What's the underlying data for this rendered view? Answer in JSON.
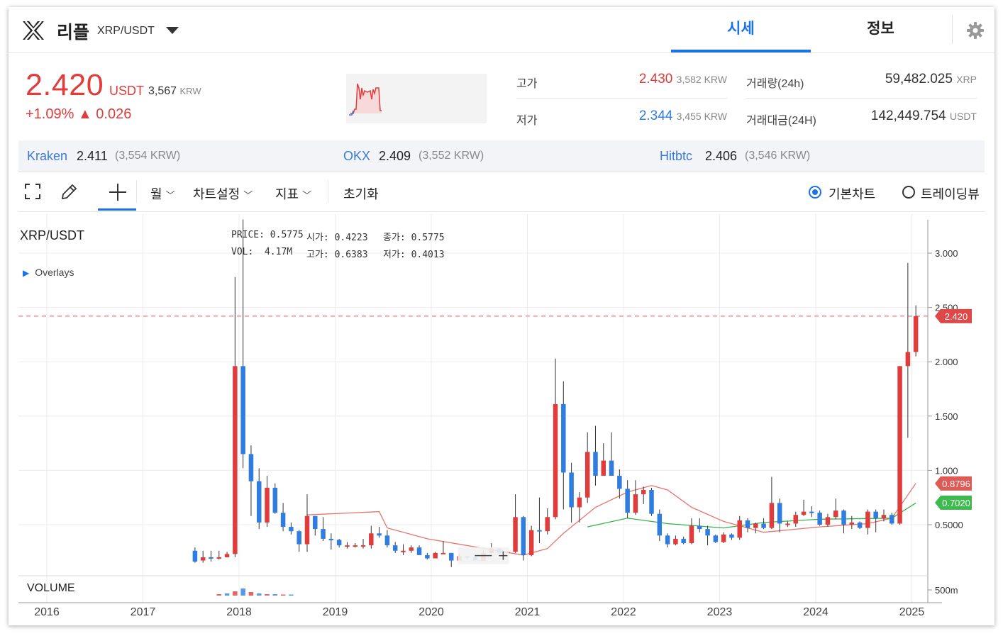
{
  "header": {
    "coin_name": "리플",
    "pair": "XRP/USDT",
    "tabs": [
      {
        "label": "시세",
        "active": true
      },
      {
        "label": "정보",
        "active": false
      }
    ]
  },
  "price": {
    "last": "2.420",
    "unit": "USDT",
    "krw": "3,567",
    "krw_unit": "KRW",
    "change": "+1.09% ▲ 0.026"
  },
  "stats": {
    "high_label": "고가",
    "high_value": "2.430",
    "high_krw": "3,582 KRW",
    "low_label": "저가",
    "low_value": "2.344",
    "low_krw": "3,455 KRW",
    "vol_label": "거래량(24h)",
    "vol_value": "59,482.025",
    "vol_unit": "XRP",
    "amt_label": "거래대금(24H)",
    "amt_value": "142,449.754",
    "amt_unit": "USDT"
  },
  "exchanges": [
    {
      "name": "Kraken",
      "price": "2.411",
      "krw": "(3,554 KRW)"
    },
    {
      "name": "OKX",
      "price": "2.409",
      "krw": "(3,552 KRW)"
    },
    {
      "name": "Hitbtc",
      "price": "2.406",
      "krw": "(3,546 KRW)"
    }
  ],
  "toolbar": {
    "period": "월",
    "chart_settings": "차트설정",
    "indicators": "지표",
    "reset": "초기화",
    "basic_chart": "기본차트",
    "tradingview": "트레이딩뷰"
  },
  "chart": {
    "pair_label": "XRP/USDT",
    "overlays_label": "Overlays",
    "volume_label": "VOLUME",
    "legend": {
      "price_label": "PRICE:",
      "price": "0.5775",
      "open_label": "시가:",
      "open": "0.4223",
      "close_label": "종가:",
      "close": "0.5775",
      "vol_label": "VOL:",
      "vol": "4.17M",
      "high_label": "고가:",
      "high": "0.6383",
      "low_label": "저가:",
      "low": "0.4013"
    },
    "y_ticks": [
      "3.000",
      "2.500",
      "2.000",
      "1.500",
      "1.000",
      "0.5000"
    ],
    "vol_tick": "500m",
    "x_ticks": [
      "2016",
      "2017",
      "2018",
      "2019",
      "2020",
      "2021",
      "2022",
      "2023",
      "2024",
      "2025"
    ],
    "price_tag": "2.420",
    "ma_tag_1": "0.8796",
    "ma_tag_2": "0.7020",
    "colors": {
      "up": "#e03c3c",
      "down": "#2f7de1",
      "ma1": "#e8746a",
      "ma2": "#37b24d"
    }
  },
  "chart_data": {
    "type": "candlestick",
    "x_unit": "month",
    "series": [
      {
        "date": "2017-07",
        "o": 0.26,
        "h": 0.29,
        "l": 0.15,
        "c": 0.16
      },
      {
        "date": "2017-08",
        "o": 0.17,
        "h": 0.26,
        "l": 0.15,
        "c": 0.2
      },
      {
        "date": "2017-09",
        "o": 0.2,
        "h": 0.26,
        "l": 0.16,
        "c": 0.19
      },
      {
        "date": "2017-10",
        "o": 0.19,
        "h": 0.26,
        "l": 0.18,
        "c": 0.2
      },
      {
        "date": "2017-11",
        "o": 0.2,
        "h": 0.25,
        "l": 0.2,
        "c": 0.23
      },
      {
        "date": "2017-12",
        "o": 0.23,
        "h": 2.78,
        "l": 0.2,
        "c": 1.96
      },
      {
        "date": "2018-01",
        "o": 1.96,
        "h": 3.31,
        "l": 1.02,
        "c": 1.15
      },
      {
        "date": "2018-02",
        "o": 1.15,
        "h": 1.23,
        "l": 0.58,
        "c": 0.9
      },
      {
        "date": "2018-03",
        "o": 0.9,
        "h": 1.02,
        "l": 0.46,
        "c": 0.52
      },
      {
        "date": "2018-04",
        "o": 0.52,
        "h": 0.95,
        "l": 0.48,
        "c": 0.84
      },
      {
        "date": "2018-05",
        "o": 0.84,
        "h": 0.88,
        "l": 0.6,
        "c": 0.61
      },
      {
        "date": "2018-06",
        "o": 0.61,
        "h": 0.7,
        "l": 0.44,
        "c": 0.48
      },
      {
        "date": "2018-07",
        "o": 0.48,
        "h": 0.52,
        "l": 0.41,
        "c": 0.44
      },
      {
        "date": "2018-08",
        "o": 0.44,
        "h": 0.45,
        "l": 0.25,
        "c": 0.32
      },
      {
        "date": "2018-09",
        "o": 0.32,
        "h": 0.78,
        "l": 0.25,
        "c": 0.58
      },
      {
        "date": "2018-10",
        "o": 0.58,
        "h": 0.58,
        "l": 0.4,
        "c": 0.46
      },
      {
        "date": "2018-11",
        "o": 0.46,
        "h": 0.57,
        "l": 0.35,
        "c": 0.37
      },
      {
        "date": "2018-12",
        "o": 0.37,
        "h": 0.42,
        "l": 0.27,
        "c": 0.36
      },
      {
        "date": "2019-01",
        "o": 0.36,
        "h": 0.37,
        "l": 0.29,
        "c": 0.31
      },
      {
        "date": "2019-02",
        "o": 0.31,
        "h": 0.34,
        "l": 0.28,
        "c": 0.31
      },
      {
        "date": "2019-03",
        "o": 0.31,
        "h": 0.33,
        "l": 0.29,
        "c": 0.31
      },
      {
        "date": "2019-04",
        "o": 0.31,
        "h": 0.37,
        "l": 0.28,
        "c": 0.31
      },
      {
        "date": "2019-05",
        "o": 0.31,
        "h": 0.49,
        "l": 0.28,
        "c": 0.42
      },
      {
        "date": "2019-06",
        "o": 0.42,
        "h": 0.48,
        "l": 0.38,
        "c": 0.4
      },
      {
        "date": "2019-07",
        "o": 0.4,
        "h": 0.45,
        "l": 0.29,
        "c": 0.31
      },
      {
        "date": "2019-08",
        "o": 0.31,
        "h": 0.34,
        "l": 0.24,
        "c": 0.26
      },
      {
        "date": "2019-09",
        "o": 0.26,
        "h": 0.32,
        "l": 0.22,
        "c": 0.26
      },
      {
        "date": "2019-10",
        "o": 0.26,
        "h": 0.31,
        "l": 0.24,
        "c": 0.29
      },
      {
        "date": "2019-11",
        "o": 0.29,
        "h": 0.31,
        "l": 0.22,
        "c": 0.22
      },
      {
        "date": "2019-12",
        "o": 0.22,
        "h": 0.24,
        "l": 0.18,
        "c": 0.19
      },
      {
        "date": "2020-01",
        "o": 0.19,
        "h": 0.25,
        "l": 0.19,
        "c": 0.24
      },
      {
        "date": "2020-02",
        "o": 0.24,
        "h": 0.35,
        "l": 0.23,
        "c": 0.24
      },
      {
        "date": "2020-03",
        "o": 0.24,
        "h": 0.24,
        "l": 0.11,
        "c": 0.17
      },
      {
        "date": "2020-04",
        "o": 0.17,
        "h": 0.23,
        "l": 0.17,
        "c": 0.21
      },
      {
        "date": "2020-05",
        "o": 0.21,
        "h": 0.21,
        "l": 0.18,
        "c": 0.2
      },
      {
        "date": "2020-06",
        "o": 0.2,
        "h": 0.21,
        "l": 0.17,
        "c": 0.17
      },
      {
        "date": "2020-07",
        "o": 0.17,
        "h": 0.27,
        "l": 0.17,
        "c": 0.24
      },
      {
        "date": "2020-08",
        "o": 0.24,
        "h": 0.33,
        "l": 0.23,
        "c": 0.28
      },
      {
        "date": "2020-09",
        "o": 0.28,
        "h": 0.28,
        "l": 0.24,
        "c": 0.24
      },
      {
        "date": "2020-10",
        "o": 0.24,
        "h": 0.26,
        "l": 0.24,
        "c": 0.25
      },
      {
        "date": "2020-11",
        "o": 0.25,
        "h": 0.78,
        "l": 0.24,
        "c": 0.57
      },
      {
        "date": "2020-12",
        "o": 0.57,
        "h": 0.58,
        "l": 0.17,
        "c": 0.22
      },
      {
        "date": "2021-01",
        "o": 0.22,
        "h": 0.49,
        "l": 0.21,
        "c": 0.45
      },
      {
        "date": "2021-02",
        "o": 0.45,
        "h": 0.75,
        "l": 0.33,
        "c": 0.44
      },
      {
        "date": "2021-03",
        "o": 0.44,
        "h": 0.65,
        "l": 0.41,
        "c": 0.57
      },
      {
        "date": "2021-04",
        "o": 0.57,
        "h": 2.03,
        "l": 0.55,
        "c": 1.61
      },
      {
        "date": "2021-05",
        "o": 1.61,
        "h": 1.82,
        "l": 0.64,
        "c": 0.98
      },
      {
        "date": "2021-06",
        "o": 0.98,
        "h": 1.07,
        "l": 0.52,
        "c": 0.66
      },
      {
        "date": "2021-07",
        "o": 0.66,
        "h": 0.8,
        "l": 0.52,
        "c": 0.75
      },
      {
        "date": "2021-08",
        "o": 0.75,
        "h": 1.35,
        "l": 0.7,
        "c": 1.17
      },
      {
        "date": "2021-09",
        "o": 1.17,
        "h": 1.41,
        "l": 0.86,
        "c": 0.95
      },
      {
        "date": "2021-10",
        "o": 0.95,
        "h": 1.25,
        "l": 0.96,
        "c": 1.09
      },
      {
        "date": "2021-11",
        "o": 1.09,
        "h": 1.35,
        "l": 0.96,
        "c": 0.95
      },
      {
        "date": "2021-12",
        "o": 0.95,
        "h": 1.01,
        "l": 0.74,
        "c": 0.83
      },
      {
        "date": "2022-01",
        "o": 0.83,
        "h": 0.91,
        "l": 0.56,
        "c": 0.61
      },
      {
        "date": "2022-02",
        "o": 0.61,
        "h": 0.91,
        "l": 0.59,
        "c": 0.78
      },
      {
        "date": "2022-03",
        "o": 0.78,
        "h": 0.85,
        "l": 0.69,
        "c": 0.82
      },
      {
        "date": "2022-04",
        "o": 0.82,
        "h": 0.84,
        "l": 0.58,
        "c": 0.6
      },
      {
        "date": "2022-05",
        "o": 0.6,
        "h": 0.64,
        "l": 0.35,
        "c": 0.4
      },
      {
        "date": "2022-06",
        "o": 0.4,
        "h": 0.42,
        "l": 0.29,
        "c": 0.32
      },
      {
        "date": "2022-07",
        "o": 0.32,
        "h": 0.4,
        "l": 0.31,
        "c": 0.37
      },
      {
        "date": "2022-08",
        "o": 0.37,
        "h": 0.39,
        "l": 0.32,
        "c": 0.33
      },
      {
        "date": "2022-09",
        "o": 0.33,
        "h": 0.56,
        "l": 0.32,
        "c": 0.49
      },
      {
        "date": "2022-10",
        "o": 0.49,
        "h": 0.56,
        "l": 0.43,
        "c": 0.46
      },
      {
        "date": "2022-11",
        "o": 0.46,
        "h": 0.49,
        "l": 0.31,
        "c": 0.4
      },
      {
        "date": "2022-12",
        "o": 0.4,
        "h": 0.41,
        "l": 0.33,
        "c": 0.34
      },
      {
        "date": "2023-01",
        "o": 0.34,
        "h": 0.43,
        "l": 0.33,
        "c": 0.41
      },
      {
        "date": "2023-02",
        "o": 0.41,
        "h": 0.42,
        "l": 0.36,
        "c": 0.38
      },
      {
        "date": "2023-03",
        "o": 0.38,
        "h": 0.58,
        "l": 0.36,
        "c": 0.54
      },
      {
        "date": "2023-04",
        "o": 0.54,
        "h": 0.56,
        "l": 0.43,
        "c": 0.47
      },
      {
        "date": "2023-05",
        "o": 0.47,
        "h": 0.52,
        "l": 0.42,
        "c": 0.51
      },
      {
        "date": "2023-06",
        "o": 0.51,
        "h": 0.56,
        "l": 0.46,
        "c": 0.47
      },
      {
        "date": "2023-07",
        "o": 0.47,
        "h": 0.94,
        "l": 0.46,
        "c": 0.7
      },
      {
        "date": "2023-08",
        "o": 0.7,
        "h": 0.74,
        "l": 0.43,
        "c": 0.51
      },
      {
        "date": "2023-09",
        "o": 0.51,
        "h": 0.53,
        "l": 0.48,
        "c": 0.51
      },
      {
        "date": "2023-10",
        "o": 0.51,
        "h": 0.62,
        "l": 0.48,
        "c": 0.59
      },
      {
        "date": "2023-11",
        "o": 0.59,
        "h": 0.73,
        "l": 0.58,
        "c": 0.62
      },
      {
        "date": "2023-12",
        "o": 0.62,
        "h": 0.67,
        "l": 0.57,
        "c": 0.61
      },
      {
        "date": "2024-01",
        "o": 0.61,
        "h": 0.63,
        "l": 0.49,
        "c": 0.5
      },
      {
        "date": "2024-02",
        "o": 0.5,
        "h": 0.6,
        "l": 0.48,
        "c": 0.57
      },
      {
        "date": "2024-03",
        "o": 0.57,
        "h": 0.74,
        "l": 0.55,
        "c": 0.63
      },
      {
        "date": "2024-04",
        "o": 0.63,
        "h": 0.64,
        "l": 0.42,
        "c": 0.5
      },
      {
        "date": "2024-05",
        "o": 0.5,
        "h": 0.58,
        "l": 0.46,
        "c": 0.52
      },
      {
        "date": "2024-06",
        "o": 0.52,
        "h": 0.53,
        "l": 0.46,
        "c": 0.47
      },
      {
        "date": "2024-07",
        "o": 0.47,
        "h": 0.64,
        "l": 0.41,
        "c": 0.62
      },
      {
        "date": "2024-08",
        "o": 0.62,
        "h": 0.64,
        "l": 0.43,
        "c": 0.56
      },
      {
        "date": "2024-09",
        "o": 0.56,
        "h": 0.64,
        "l": 0.53,
        "c": 0.59
      },
      {
        "date": "2024-10",
        "o": 0.59,
        "h": 0.61,
        "l": 0.5,
        "c": 0.51
      },
      {
        "date": "2024-11",
        "o": 0.51,
        "h": 1.96,
        "l": 0.5,
        "c": 1.96
      },
      {
        "date": "2024-12",
        "o": 1.96,
        "h": 2.91,
        "l": 1.3,
        "c": 2.09
      },
      {
        "date": "2025-01",
        "o": 2.09,
        "h": 2.52,
        "l": 2.05,
        "c": 2.42
      }
    ],
    "ma_slow": [
      {
        "date": "2018-09",
        "v": 0.59
      },
      {
        "date": "2019-06",
        "v": 0.62
      },
      {
        "date": "2019-07",
        "v": 0.47
      },
      {
        "date": "2019-12",
        "v": 0.37
      },
      {
        "date": "2020-12",
        "v": 0.22
      },
      {
        "date": "2021-03",
        "v": 0.28
      },
      {
        "date": "2021-05",
        "v": 0.42
      },
      {
        "date": "2021-09",
        "v": 0.66
      },
      {
        "date": "2022-01",
        "v": 0.8
      },
      {
        "date": "2022-04",
        "v": 0.86
      },
      {
        "date": "2022-06",
        "v": 0.82
      },
      {
        "date": "2022-09",
        "v": 0.66
      },
      {
        "date": "2023-01",
        "v": 0.53
      },
      {
        "date": "2023-06",
        "v": 0.43
      },
      {
        "date": "2024-01",
        "v": 0.48
      },
      {
        "date": "2024-07",
        "v": 0.51
      },
      {
        "date": "2024-10",
        "v": 0.56
      },
      {
        "date": "2025-01",
        "v": 0.88
      }
    ],
    "ma_fast": [
      {
        "date": "2021-08",
        "v": 0.48
      },
      {
        "date": "2022-01",
        "v": 0.56
      },
      {
        "date": "2022-06",
        "v": 0.51
      },
      {
        "date": "2023-01",
        "v": 0.47
      },
      {
        "date": "2023-06",
        "v": 0.52
      },
      {
        "date": "2024-01",
        "v": 0.55
      },
      {
        "date": "2024-10",
        "v": 0.56
      },
      {
        "date": "2025-01",
        "v": 0.7
      }
    ],
    "ylim": [
      0.15,
      3.4
    ],
    "current_price": 2.42
  }
}
